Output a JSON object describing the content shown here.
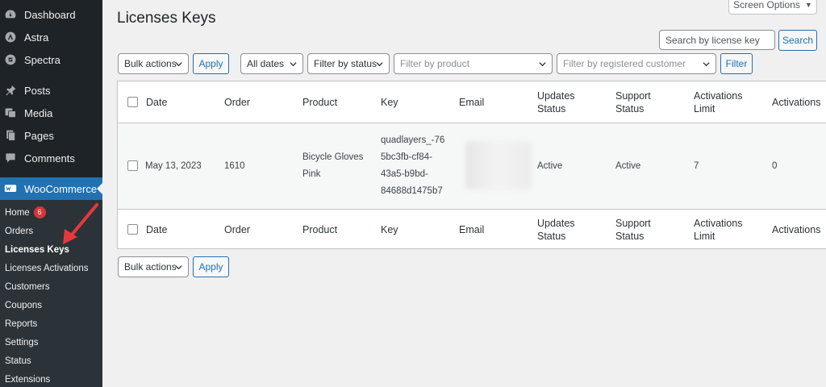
{
  "sidebar": {
    "top_items": [
      {
        "label": "Dashboard",
        "icon": "dashboard-icon"
      },
      {
        "label": "Astra",
        "icon": "astra-icon"
      },
      {
        "label": "Spectra",
        "icon": "spectra-icon"
      }
    ],
    "content_items": [
      {
        "label": "Posts",
        "icon": "pin-icon"
      },
      {
        "label": "Media",
        "icon": "media-icon"
      },
      {
        "label": "Pages",
        "icon": "pages-icon"
      },
      {
        "label": "Comments",
        "icon": "comments-icon"
      }
    ],
    "woocommerce": {
      "label": "WooCommerce",
      "icon": "woocommerce-icon"
    },
    "submenu": [
      {
        "label": "Home",
        "badge": "6"
      },
      {
        "label": "Orders"
      },
      {
        "label": "Licenses Keys",
        "current": true
      },
      {
        "label": "Licenses Activations"
      },
      {
        "label": "Customers"
      },
      {
        "label": "Coupons"
      },
      {
        "label": "Reports"
      },
      {
        "label": "Settings"
      },
      {
        "label": "Status"
      },
      {
        "label": "Extensions"
      }
    ]
  },
  "page": {
    "title": "Licenses Keys",
    "screen_options": "Screen Options",
    "search_placeholder": "Search by license key",
    "search_button": "Search"
  },
  "filters": {
    "bulk_actions": "Bulk actions",
    "apply": "Apply",
    "all_dates": "All dates",
    "filter_status": "Filter by status",
    "filter_product": "Filter by product",
    "filter_customer": "Filter by registered customer",
    "filter_button": "Filter"
  },
  "table": {
    "columns": {
      "date": "Date",
      "order": "Order",
      "product": "Product",
      "key": "Key",
      "email": "Email",
      "updates_status": "Updates Status",
      "support_status": "Support Status",
      "activations_limit": "Activations Limit",
      "activations": "Activations"
    },
    "rows": [
      {
        "date": "May 13, 2023",
        "order": "1610",
        "product_line1": "Bicycle Gloves",
        "product_line2": "Pink",
        "key_line1": "quadlayers_-76",
        "key_line2": "5bc3fb-cf84-",
        "key_line3": "43a5-b9bd-",
        "key_line4": "84688d1475b7",
        "updates_status": "Active",
        "support_status": "Active",
        "activations_limit": "7",
        "activations": "0"
      }
    ]
  },
  "bottom": {
    "bulk_actions": "Bulk actions",
    "apply": "Apply"
  },
  "colors": {
    "sidebar_bg": "#1d2327",
    "accent": "#2271b1",
    "arrow": "#e8383d"
  }
}
